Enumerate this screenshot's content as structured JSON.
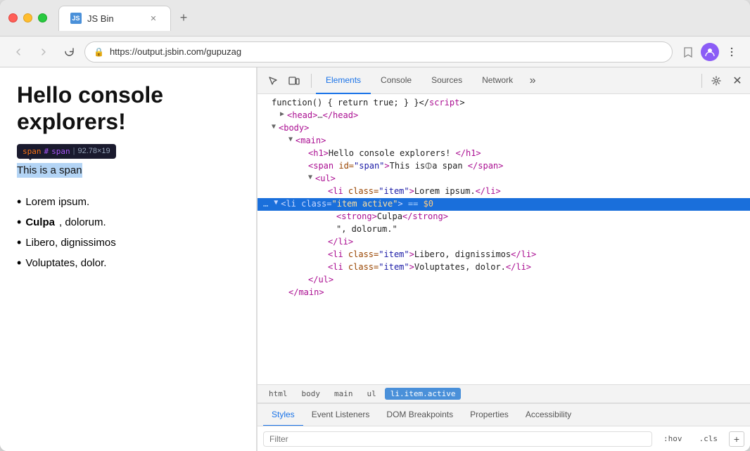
{
  "browser": {
    "tab_favicon": "JS",
    "tab_title": "JS Bin",
    "url": "https://output.jsbin.com/gupuzag",
    "back_disabled": true,
    "forward_disabled": true
  },
  "webpage": {
    "heading": "Hello console explorers!",
    "tooltip": {
      "span_text": "span",
      "hash_text": "#",
      "id_text": "span",
      "separator": "|",
      "dimensions": "92.78×19"
    },
    "span_text": "This is a span",
    "list_items": [
      {
        "text": "Lorem ipsum.",
        "bold": false
      },
      {
        "bold_part": "Culpa",
        "rest": ", dolorum.",
        "bold": true
      },
      {
        "text": "Libero, dignissimos",
        "bold": false
      },
      {
        "text": "Voluptates, dolor.",
        "bold": false
      }
    ]
  },
  "devtools": {
    "tabs": [
      {
        "label": "Elements",
        "active": true
      },
      {
        "label": "Console",
        "active": false
      },
      {
        "label": "Sources",
        "active": false
      },
      {
        "label": "Network",
        "active": false
      }
    ],
    "dom_lines": [
      {
        "indent": 0,
        "content": "function() { return true; } }</",
        "tag_end": "script>",
        "id": "line1"
      },
      {
        "indent": 4,
        "expand": "▶",
        "tag_open": "<head>",
        "ellipsis": "…",
        "tag_close": "</head>",
        "id": "line2"
      },
      {
        "indent": 2,
        "expand": "▼",
        "tag": "body",
        "id": "line3"
      },
      {
        "indent": 6,
        "expand": "▼",
        "tag": "main",
        "id": "line4"
      },
      {
        "indent": 10,
        "full": "<h1>Hello console explorers! </h1>",
        "id": "line5"
      },
      {
        "indent": 10,
        "full_span": true,
        "id": "line6"
      },
      {
        "indent": 10,
        "expand": "▼",
        "tag": "ul",
        "id": "line7"
      },
      {
        "indent": 14,
        "li_class": "item",
        "li_text": "Lorem ipsum.",
        "id": "line8"
      },
      {
        "indent": 10,
        "selected": true,
        "id": "line9"
      },
      {
        "indent": 14,
        "full": "<strong>Culpa</strong>",
        "id": "line10"
      },
      {
        "indent": 14,
        "text_only": "\", dolorum.\"",
        "id": "line11"
      },
      {
        "indent": 10,
        "close_tag": "li",
        "id": "line12"
      },
      {
        "indent": 14,
        "li_class": "item",
        "li_text": "Libero, dignissimos",
        "id": "line13"
      },
      {
        "indent": 14,
        "li_class": "item",
        "li_text": "Voluptates, dolor.",
        "id": "line14"
      },
      {
        "indent": 10,
        "close_tag": "ul",
        "id": "line15"
      },
      {
        "indent": 10,
        "close_tag": "main",
        "id": "line16"
      }
    ],
    "breadcrumbs": [
      {
        "label": "html",
        "active": false
      },
      {
        "label": "body",
        "active": false
      },
      {
        "label": "main",
        "active": false
      },
      {
        "label": "ul",
        "active": false
      },
      {
        "label": "li.item.active",
        "active": true
      }
    ],
    "bottom_tabs": [
      {
        "label": "Styles",
        "active": true
      },
      {
        "label": "Event Listeners",
        "active": false
      },
      {
        "label": "DOM Breakpoints",
        "active": false
      },
      {
        "label": "Properties",
        "active": false
      },
      {
        "label": "Accessibility",
        "active": false
      }
    ],
    "filter_placeholder": "Filter",
    "filter_hov": ":hov",
    "filter_cls": ".cls",
    "filter_plus": "+"
  }
}
